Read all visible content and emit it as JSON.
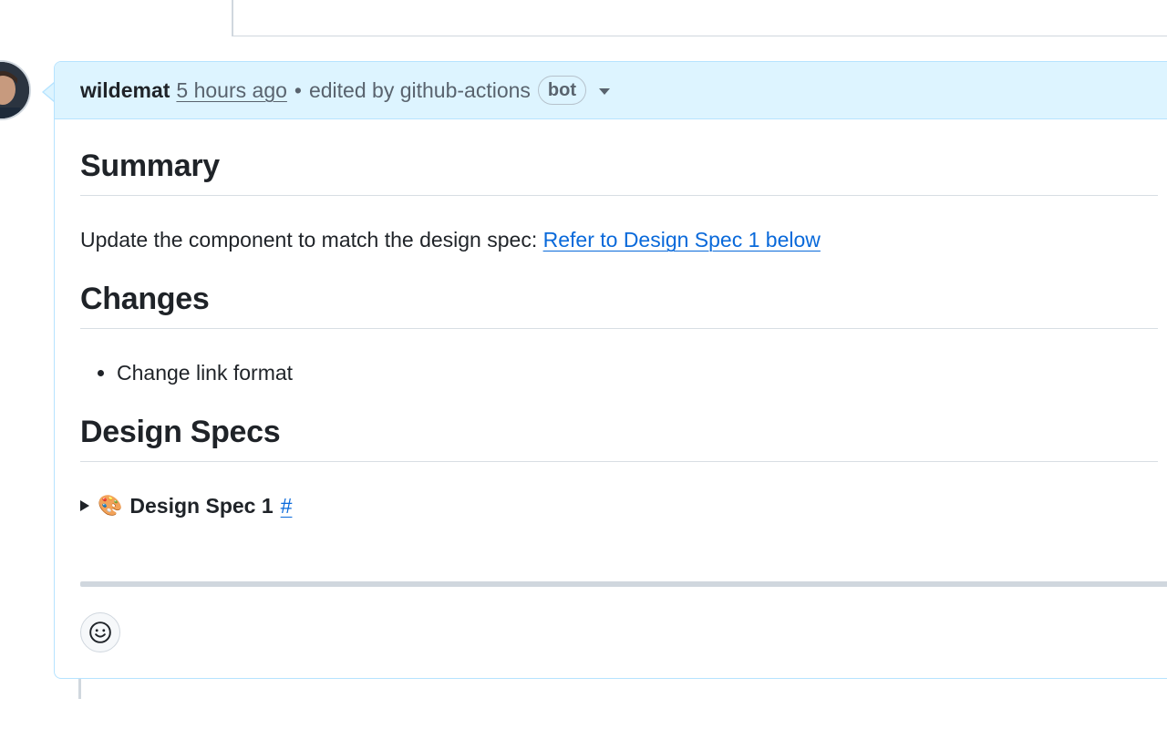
{
  "comment": {
    "author": "wildemat",
    "timestamp": "5 hours ago",
    "separator": "•",
    "edited_by": "edited by github-actions",
    "badge": "bot"
  },
  "body": {
    "summary_heading": "Summary",
    "summary_text": "Update the component to match the design spec:",
    "summary_link": "Refer to Design Spec 1 below",
    "changes_heading": "Changes",
    "changes_items": [
      "Change link format"
    ],
    "specs_heading": "Design Specs",
    "spec_emoji": "🎨",
    "spec_title": "Design Spec 1",
    "spec_anchor": "#"
  },
  "icons": {
    "avatar": "avatar",
    "caret": "chevron-down-icon",
    "disclosure": "triangle-right-icon",
    "reaction": "smiley-icon"
  },
  "colors": {
    "header_bg": "#ddf4ff",
    "header_border": "#b6e3ff",
    "link": "#0969da",
    "text": "#1f2328",
    "muted": "#59636e"
  }
}
